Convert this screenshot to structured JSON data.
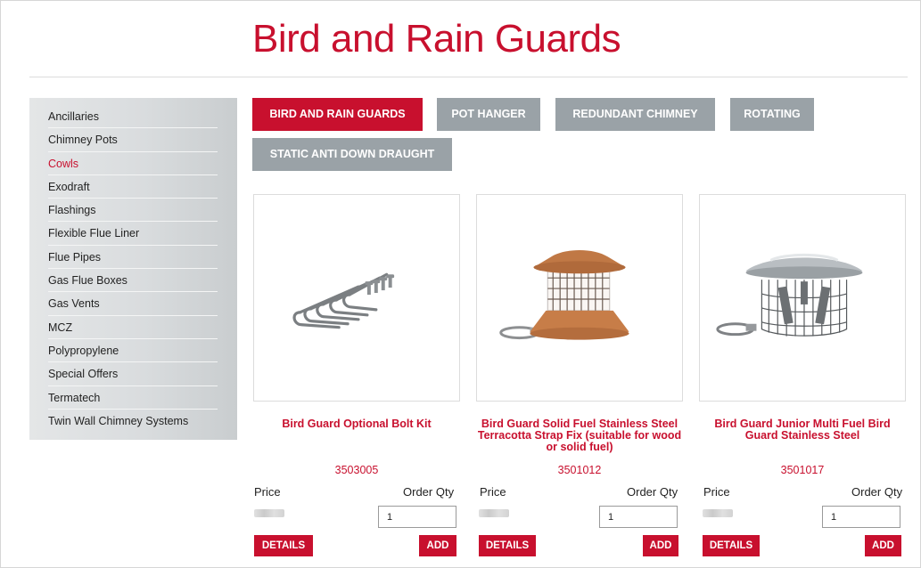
{
  "page": {
    "title": "Bird and Rain Guards"
  },
  "sidebar": {
    "items": [
      {
        "label": "Ancillaries",
        "active": false
      },
      {
        "label": "Chimney Pots",
        "active": false
      },
      {
        "label": "Cowls",
        "active": true
      },
      {
        "label": "Exodraft",
        "active": false
      },
      {
        "label": "Flashings",
        "active": false
      },
      {
        "label": "Flexible Flue Liner",
        "active": false
      },
      {
        "label": "Flue Pipes",
        "active": false
      },
      {
        "label": "Gas Flue Boxes",
        "active": false
      },
      {
        "label": "Gas Vents",
        "active": false
      },
      {
        "label": "MCZ",
        "active": false
      },
      {
        "label": "Polypropylene",
        "active": false
      },
      {
        "label": "Special Offers",
        "active": false
      },
      {
        "label": "Termatech",
        "active": false
      },
      {
        "label": "Twin Wall Chimney Systems",
        "active": false
      }
    ]
  },
  "tabs": [
    {
      "label": "BIRD AND RAIN GUARDS",
      "active": true
    },
    {
      "label": "POT HANGER",
      "active": false
    },
    {
      "label": "REDUNDANT CHIMNEY",
      "active": false
    },
    {
      "label": "ROTATING",
      "active": false
    },
    {
      "label": "STATIC ANTI DOWN DRAUGHT",
      "active": false
    }
  ],
  "products": [
    {
      "name": "Bird Guard Optional Bolt Kit",
      "code": "3503005",
      "price_label": "Price",
      "qty_label": "Order Qty",
      "qty_value": "1",
      "details_label": "DETAILS",
      "add_label": "ADD",
      "image_icon": "bolt-kit-image"
    },
    {
      "name": "Bird Guard Solid Fuel Stainless Steel Terracotta Strap Fix (suitable for wood or solid fuel)",
      "code": "3501012",
      "price_label": "Price",
      "qty_label": "Order Qty",
      "qty_value": "1",
      "details_label": "DETAILS",
      "add_label": "ADD",
      "image_icon": "terracotta-bird-guard-image"
    },
    {
      "name": "Bird Guard Junior Multi Fuel Bird Guard Stainless Steel",
      "code": "3501017",
      "price_label": "Price",
      "qty_label": "Order Qty",
      "qty_value": "1",
      "details_label": "DETAILS",
      "add_label": "ADD",
      "image_icon": "stainless-bird-guard-image"
    }
  ],
  "colors": {
    "accent": "#c8102e",
    "tab_inactive": "#9aa2a7",
    "sidebar_bg": "#dadddf"
  }
}
